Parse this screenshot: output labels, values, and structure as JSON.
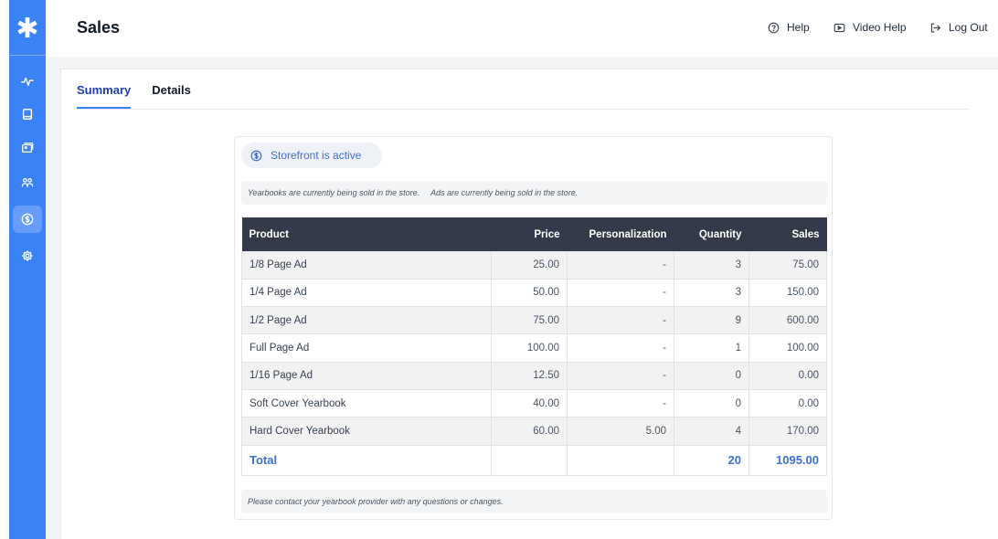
{
  "app": {
    "logo_glyph": "✱",
    "accent": "#3b82f6",
    "header_bg": "#343a4a",
    "link_color": "#3b6fd6"
  },
  "sidebar": {
    "items": [
      {
        "name": "activity",
        "icon": "activity-icon",
        "active": false
      },
      {
        "name": "book",
        "icon": "book-icon",
        "active": false
      },
      {
        "name": "images",
        "icon": "images-icon",
        "active": false
      },
      {
        "name": "users",
        "icon": "users-icon",
        "active": false
      },
      {
        "name": "sales",
        "icon": "dollar-circle-icon",
        "active": true
      },
      {
        "name": "settings",
        "icon": "gear-icon",
        "active": false
      }
    ]
  },
  "header": {
    "title": "Sales",
    "help_label": "Help",
    "video_help_label": "Video Help",
    "logout_label": "Log Out"
  },
  "tabs": [
    {
      "label": "Summary",
      "active": true
    },
    {
      "label": "Details",
      "active": false
    }
  ],
  "status": {
    "label": "Storefront is active"
  },
  "notes": {
    "yearbooks": "Yearbooks are currently being sold in the store.",
    "ads": "Ads are currently being sold in the store.",
    "footer": "Please contact your yearbook provider with any questions or changes."
  },
  "table": {
    "columns": [
      "Product",
      "Price",
      "Personalization",
      "Quantity",
      "Sales"
    ],
    "rows": [
      {
        "product": "1/8 Page Ad",
        "price": "25.00",
        "personalization": "-",
        "quantity": "3",
        "sales": "75.00"
      },
      {
        "product": "1/4 Page Ad",
        "price": "50.00",
        "personalization": "-",
        "quantity": "3",
        "sales": "150.00"
      },
      {
        "product": "1/2 Page Ad",
        "price": "75.00",
        "personalization": "-",
        "quantity": "9",
        "sales": "600.00"
      },
      {
        "product": "Full Page Ad",
        "price": "100.00",
        "personalization": "-",
        "quantity": "1",
        "sales": "100.00"
      },
      {
        "product": "1/16 Page Ad",
        "price": "12.50",
        "personalization": "-",
        "quantity": "0",
        "sales": "0.00"
      },
      {
        "product": "Soft Cover Yearbook",
        "price": "40.00",
        "personalization": "-",
        "quantity": "0",
        "sales": "0.00"
      },
      {
        "product": "Hard Cover Yearbook",
        "price": "60.00",
        "personalization": "5.00",
        "quantity": "4",
        "sales": "170.00"
      }
    ],
    "total": {
      "label": "Total",
      "quantity": "20",
      "sales": "1095.00"
    }
  }
}
